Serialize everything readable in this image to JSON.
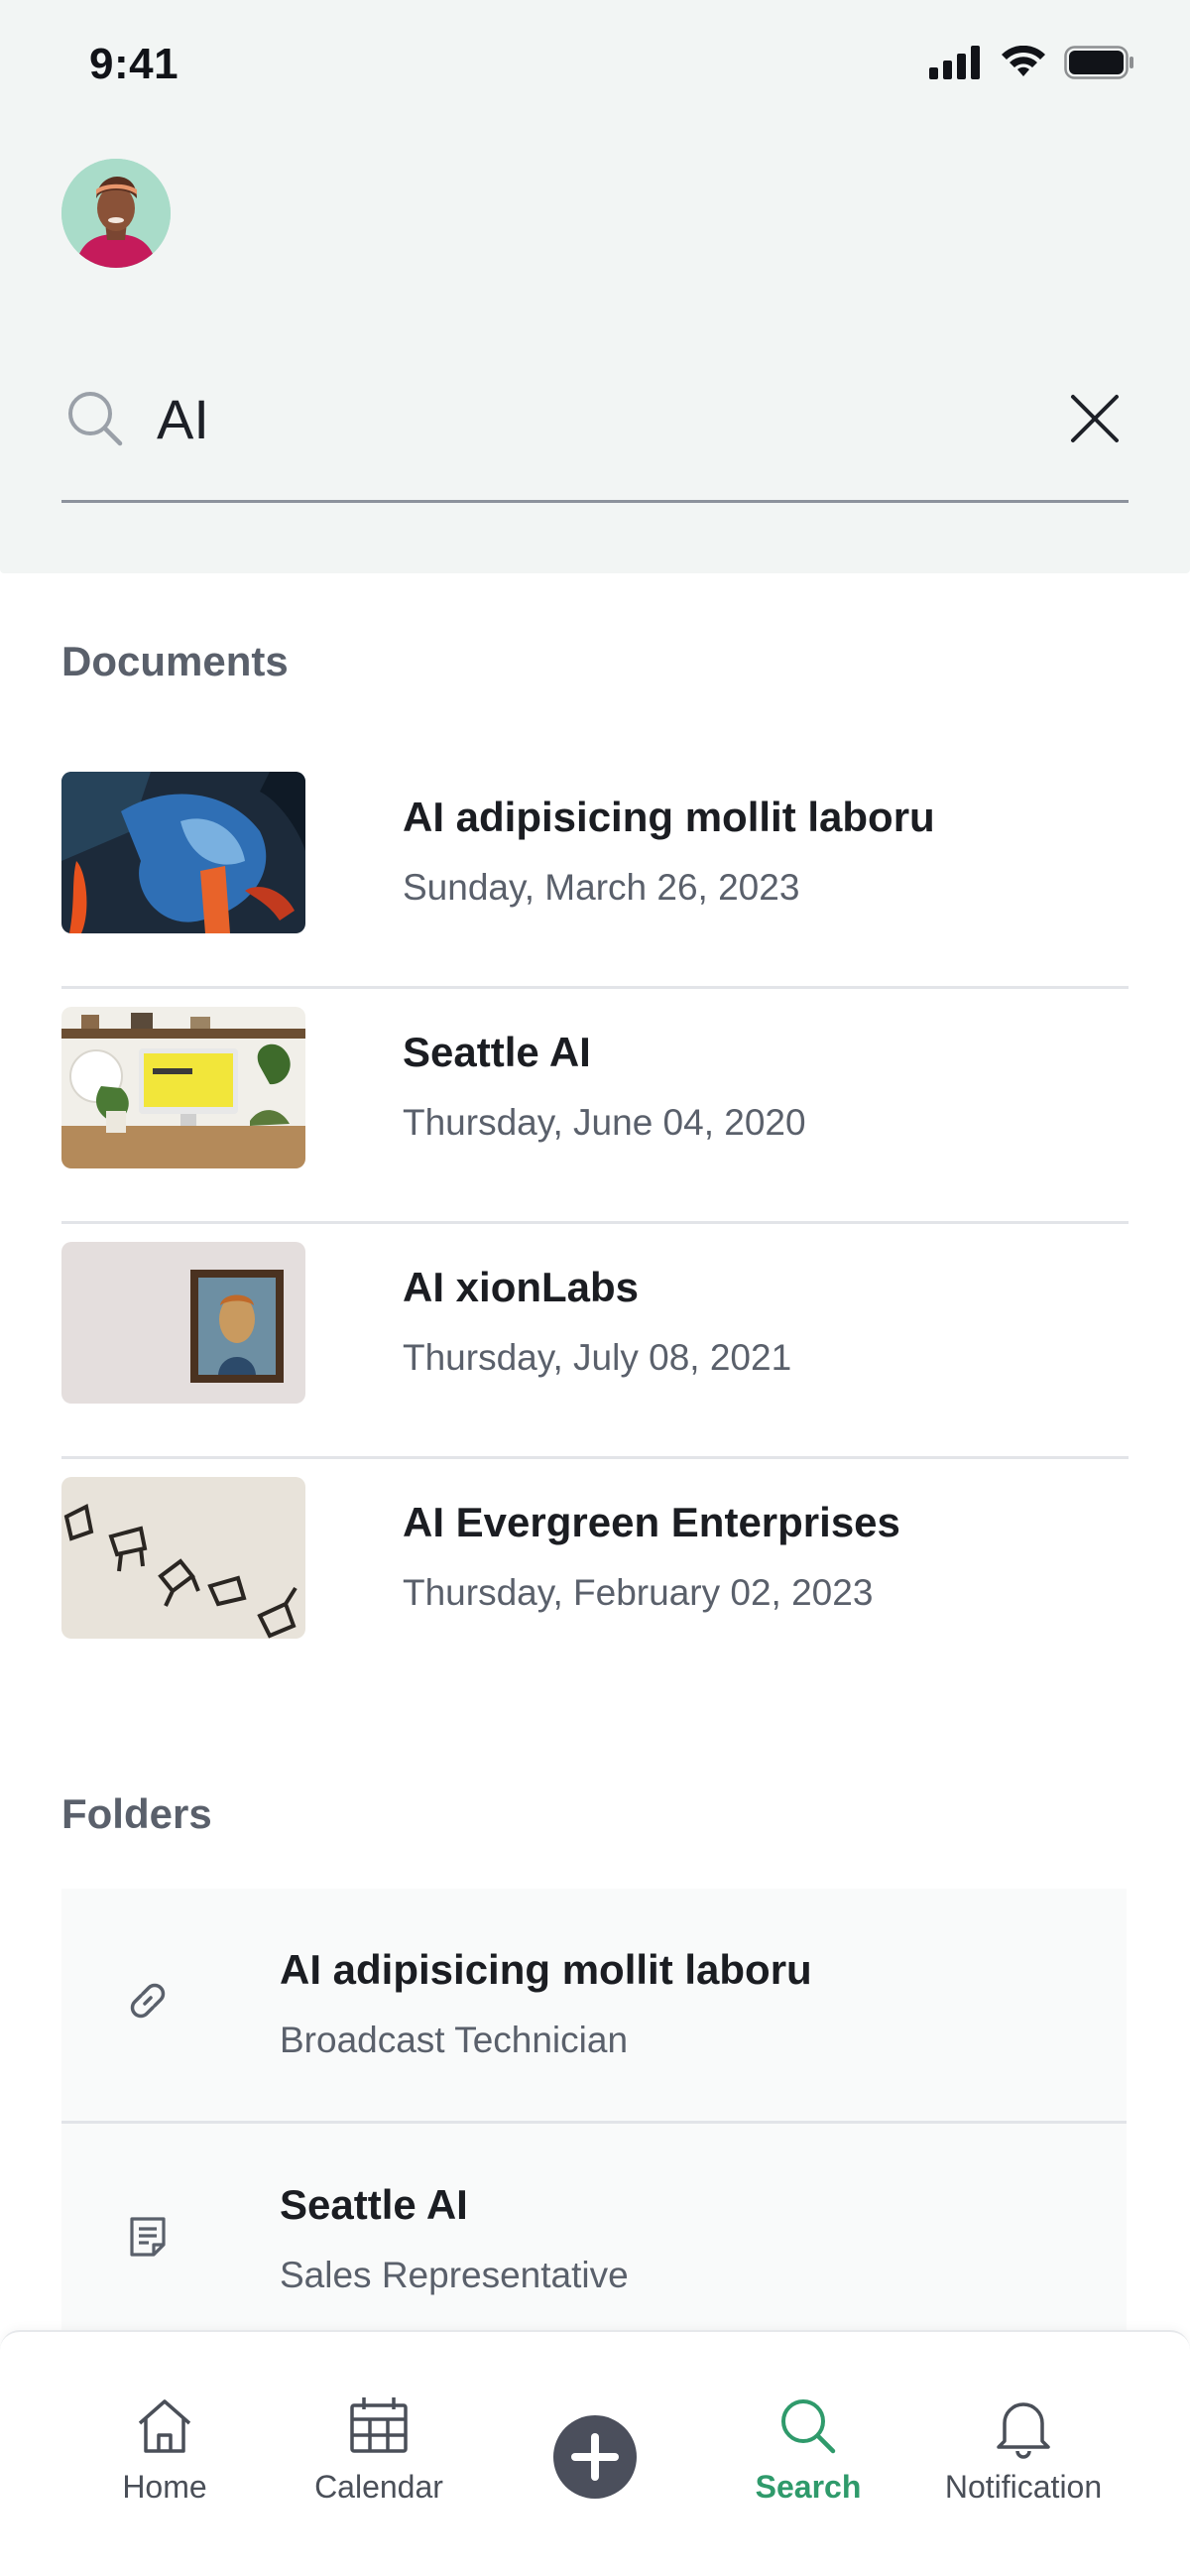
{
  "status_bar": {
    "time": "9:41"
  },
  "search": {
    "value": "AI",
    "placeholder": ""
  },
  "sections": {
    "documents_title": "Documents",
    "folders_title": "Folders"
  },
  "documents": [
    {
      "title": "AI adipisicing mollit laboru",
      "date": "Sunday, March 26, 2023"
    },
    {
      "title": "Seattle AI",
      "date": "Thursday, June 04, 2020"
    },
    {
      "title": "AI xionLabs",
      "date": "Thursday, July 08, 2021"
    },
    {
      "title": " AI Evergreen Enterprises",
      "date": "Thursday, February 02, 2023"
    }
  ],
  "folders": [
    {
      "title": "AI adipisicing mollit laboru",
      "subtitle": "Broadcast Technician",
      "icon": "link-icon"
    },
    {
      "title": "Seattle AI",
      "subtitle": "Sales Representative",
      "icon": "document-icon"
    }
  ],
  "nav": {
    "home": "Home",
    "calendar": "Calendar",
    "search": "Search",
    "notification": "Notification",
    "active": "search"
  },
  "colors": {
    "accent": "#2f9a6b",
    "header_bg": "#f2f5f4",
    "add_button": "#4b4f5c"
  }
}
